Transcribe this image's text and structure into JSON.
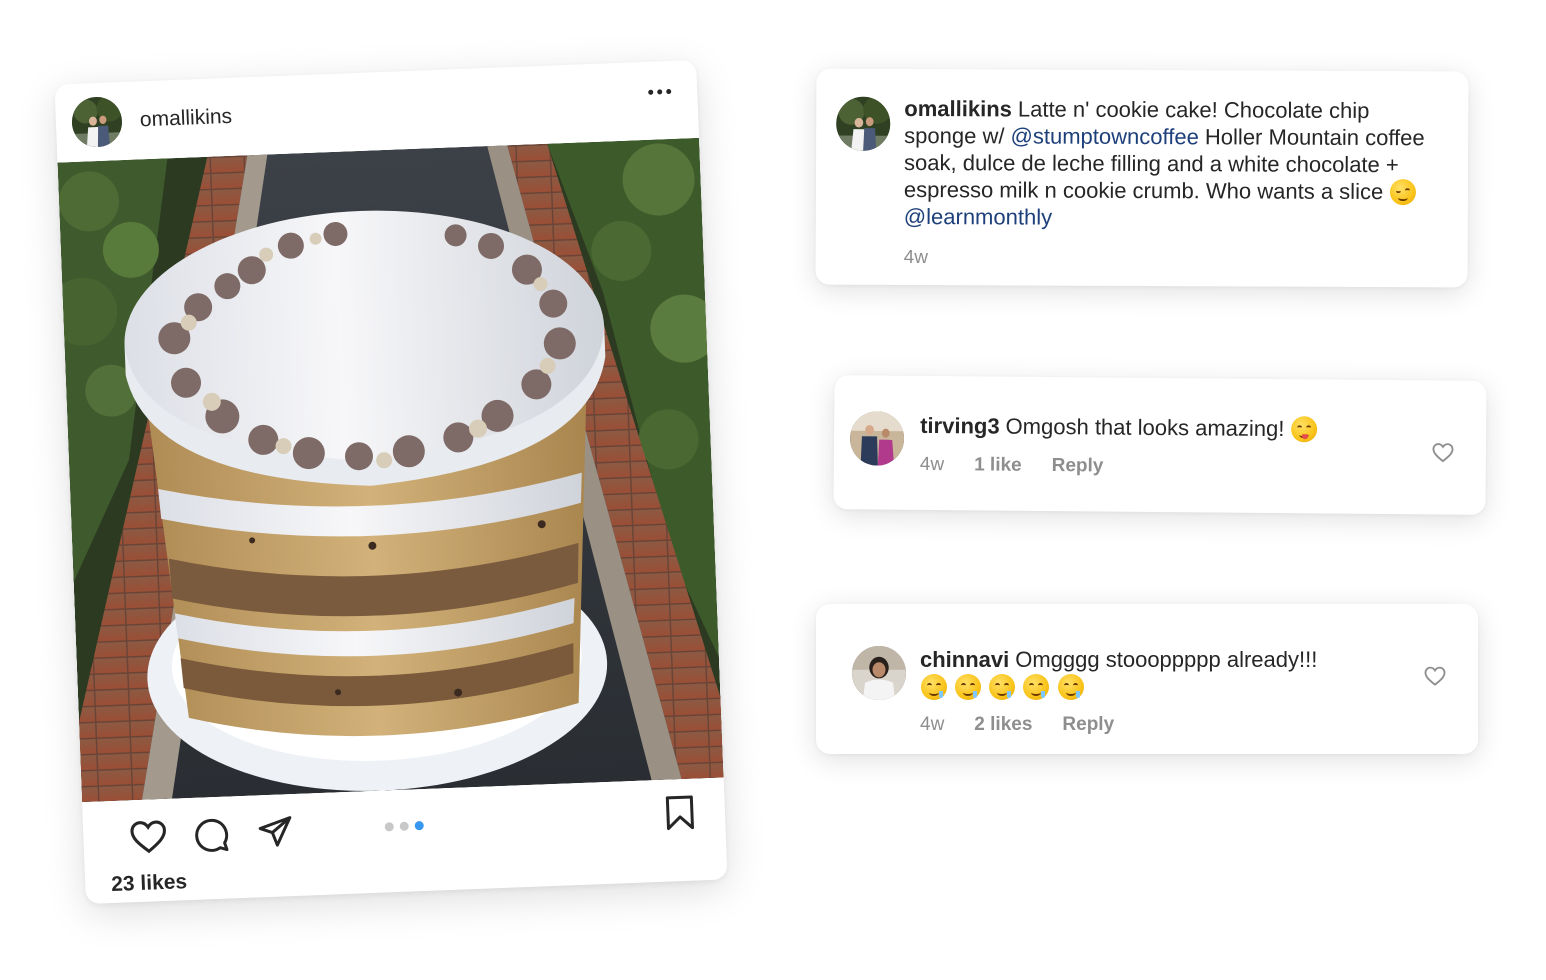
{
  "post": {
    "username": "omallikins",
    "likes": "23 likes",
    "carousel": {
      "count": 3,
      "active_index": 2
    },
    "icons": {
      "more": "more-options-icon",
      "like": "heart-icon",
      "comment": "comment-icon",
      "share": "paper-plane-icon",
      "save": "bookmark-icon"
    },
    "accent_color": "#3897f0"
  },
  "caption": {
    "username": "omallikins",
    "text_1": "Latte n' cookie cake!  Chocolate chip sponge w/ ",
    "mention_1": "@stumptowncoffee",
    "text_2": " Holler Mountain coffee soak, dulce de leche filling and a white chocolate + espresso milk n cookie crumb. Who wants a slice ",
    "emoji": "winking-face-emoji",
    "mention_2": "@learnmonthly",
    "time": "4w",
    "mention_color": "#1d3f7a"
  },
  "comments": [
    {
      "username": "tirving3",
      "text": "Omgosh that looks amazing! ",
      "emoji": "face-savoring-food-emoji",
      "time": "4w",
      "likes": "1 like",
      "reply": "Reply"
    },
    {
      "username": "chinnavi",
      "text": "Omgggg stoooppppp already!!! ",
      "emoji": "drooling-face-emoji",
      "time": "4w",
      "likes": "2 likes",
      "reply": "Reply"
    }
  ]
}
